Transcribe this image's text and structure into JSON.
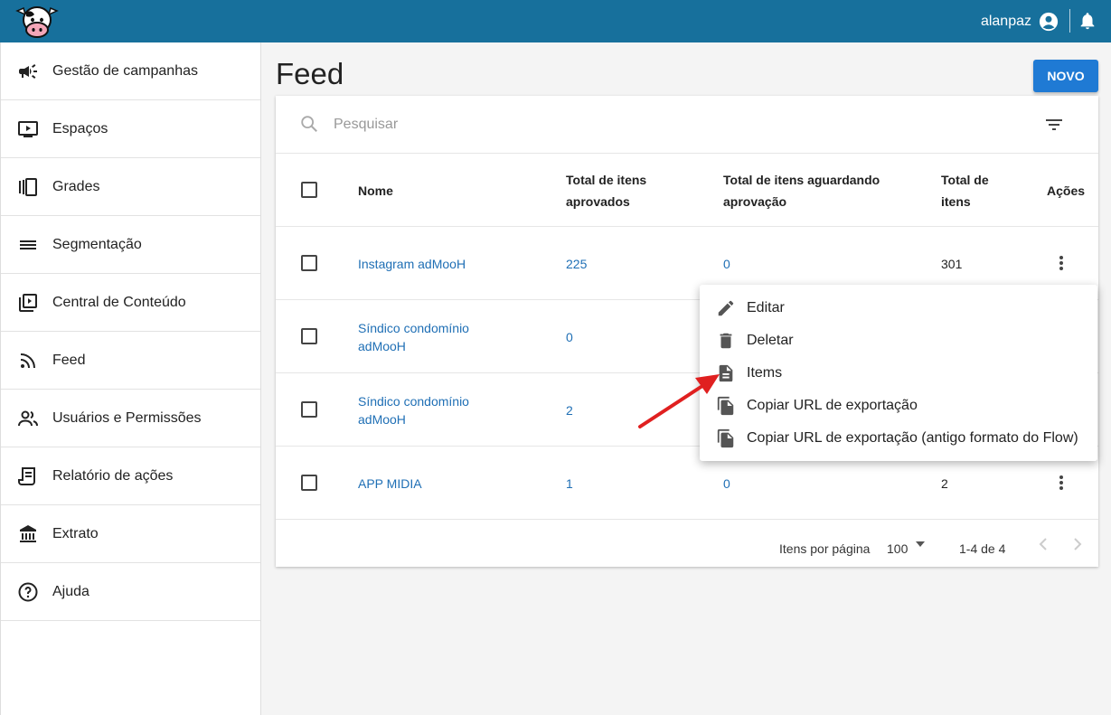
{
  "header": {
    "logo": "cow-logo",
    "username": "alanpaz",
    "colors": {
      "bar": "#17709c"
    }
  },
  "sidebar": {
    "items": [
      {
        "label": "Gestão de campanhas",
        "icon": "megaphone-icon"
      },
      {
        "label": "Espaços",
        "icon": "screen-play-icon"
      },
      {
        "label": "Grades",
        "icon": "carousel-icon"
      },
      {
        "label": "Segmentação",
        "icon": "lines-icon"
      },
      {
        "label": "Central de Conteúdo",
        "icon": "video-library-icon"
      },
      {
        "label": "Feed",
        "icon": "rss-icon"
      },
      {
        "label": "Usuários e Permissões",
        "icon": "people-icon"
      },
      {
        "label": "Relatório de ações",
        "icon": "scroll-icon"
      },
      {
        "label": "Extrato",
        "icon": "bank-icon"
      },
      {
        "label": "Ajuda",
        "icon": "help-icon"
      }
    ]
  },
  "main": {
    "title": "Feed",
    "new_button": "NOVO",
    "search": {
      "placeholder": "Pesquisar"
    },
    "table": {
      "headers": {
        "name": "Nome",
        "approved_1": "Total de itens",
        "approved_2": "aprovados",
        "pending_1": "Total de itens aguardando",
        "pending_2": "aprovação",
        "total_1": "Total de",
        "total_2": "itens",
        "actions": "Ações"
      },
      "rows": [
        {
          "name": "Instagram adMooH",
          "approved": "225",
          "pending": "0",
          "total": "301"
        },
        {
          "name": "Síndico condomínio adMooH",
          "approved": "0",
          "pending": "",
          "total": ""
        },
        {
          "name": "Síndico condomínio adMooH",
          "approved": "2",
          "pending": "",
          "total": ""
        },
        {
          "name": "APP MIDIA",
          "approved": "1",
          "pending": "0",
          "total": "2"
        }
      ]
    },
    "pagination": {
      "per_page_label": "Itens por página",
      "per_page_value": "100",
      "range": "1-4 de 4"
    },
    "context_menu": {
      "items": [
        {
          "label": "Editar",
          "icon": "pencil-icon"
        },
        {
          "label": "Deletar",
          "icon": "trash-icon"
        },
        {
          "label": "Items",
          "icon": "document-icon"
        },
        {
          "label": "Copiar URL de exportação",
          "icon": "copy-icon"
        },
        {
          "label": "Copiar URL de exportação (antigo formato do Flow)",
          "icon": "copy-icon"
        }
      ]
    }
  }
}
